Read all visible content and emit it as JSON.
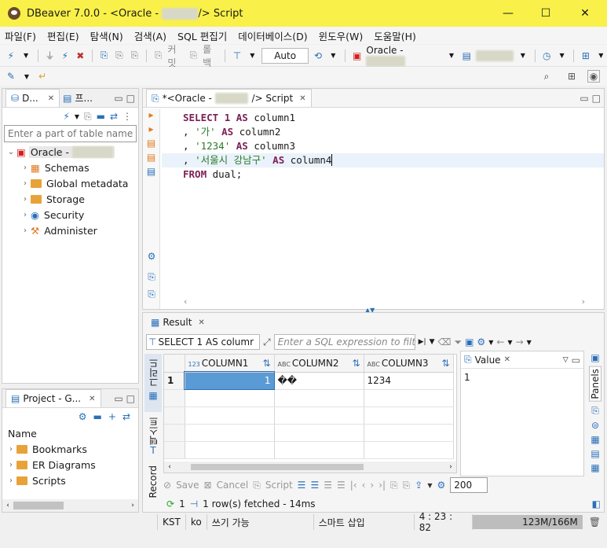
{
  "window": {
    "title_prefix": "DBeaver 7.0.0 - <Oracle - ",
    "title_hidden": "xxxxxx",
    "title_suffix": "/> Script"
  },
  "menu": [
    "파일(F)",
    "편집(E)",
    "탐색(N)",
    "검색(A)",
    "SQL 편집기",
    "데이터베이스(D)",
    "윈도우(W)",
    "도움말(H)"
  ],
  "toolbar": {
    "commit_label": "커밋",
    "rollback_label": "롤백",
    "mode": "Auto",
    "datasource_prefix": "Oracle - ",
    "datasource_hidden": "xxxxxxx"
  },
  "navigator": {
    "tab_label": "D...",
    "tab2_label": "프...",
    "filter_placeholder": "Enter a part of table name",
    "root_label": "Oracle - ",
    "root_hidden": "xxxxxxx",
    "items": [
      "Schemas",
      "Global metadata",
      "Storage",
      "Security",
      "Administer"
    ]
  },
  "project": {
    "tab_label": "Project - G...",
    "column_header": "Name",
    "items": [
      "Bookmarks",
      "ER Diagrams",
      "Scripts"
    ]
  },
  "editor": {
    "tab_prefix": "*<Oracle - ",
    "tab_hidden": "xxxxxx",
    "tab_suffix": "/> Script",
    "lines": [
      {
        "k1": "SELECT",
        "n": "1",
        "k2": "AS",
        "id": "column1",
        "pre": ""
      },
      {
        "pre": ", ",
        "s": "'가'",
        "k2": "AS",
        "id": "column2"
      },
      {
        "pre": ", ",
        "s": "'1234'",
        "k2": "AS",
        "id": "column3"
      },
      {
        "pre": ", ",
        "s": "'서울시 강남구'",
        "k2": "AS",
        "id": "column4"
      },
      {
        "k1": "FROM",
        "id": "dual;"
      }
    ]
  },
  "result": {
    "tab_label": "Result",
    "query_label": "SELECT 1 AS columr",
    "filter_placeholder": "Enter a SQL expression to filt",
    "columns": [
      "COLUMN1",
      "COLUMN2",
      "COLUMN3"
    ],
    "rows": [
      {
        "num": "1",
        "c1": "1",
        "c2": "��",
        "c3": "1234"
      }
    ],
    "vtabs": [
      "그리드",
      "텍스트",
      "Record"
    ],
    "footer_buttons": [
      "Save",
      "Cancel",
      "Script"
    ],
    "fetch_limit": "200",
    "refresh_count": "1",
    "fetched": "1 row(s) fetched - 14ms"
  },
  "value_panel": {
    "title": "Value",
    "value": "1",
    "panels_label": "Panels"
  },
  "status": {
    "tz": "KST",
    "lang": "ko",
    "mode": "쓰기 가능",
    "insert": "스마트 삽입",
    "pos": "4 : 23 : 82",
    "memory": "123M/166M"
  }
}
